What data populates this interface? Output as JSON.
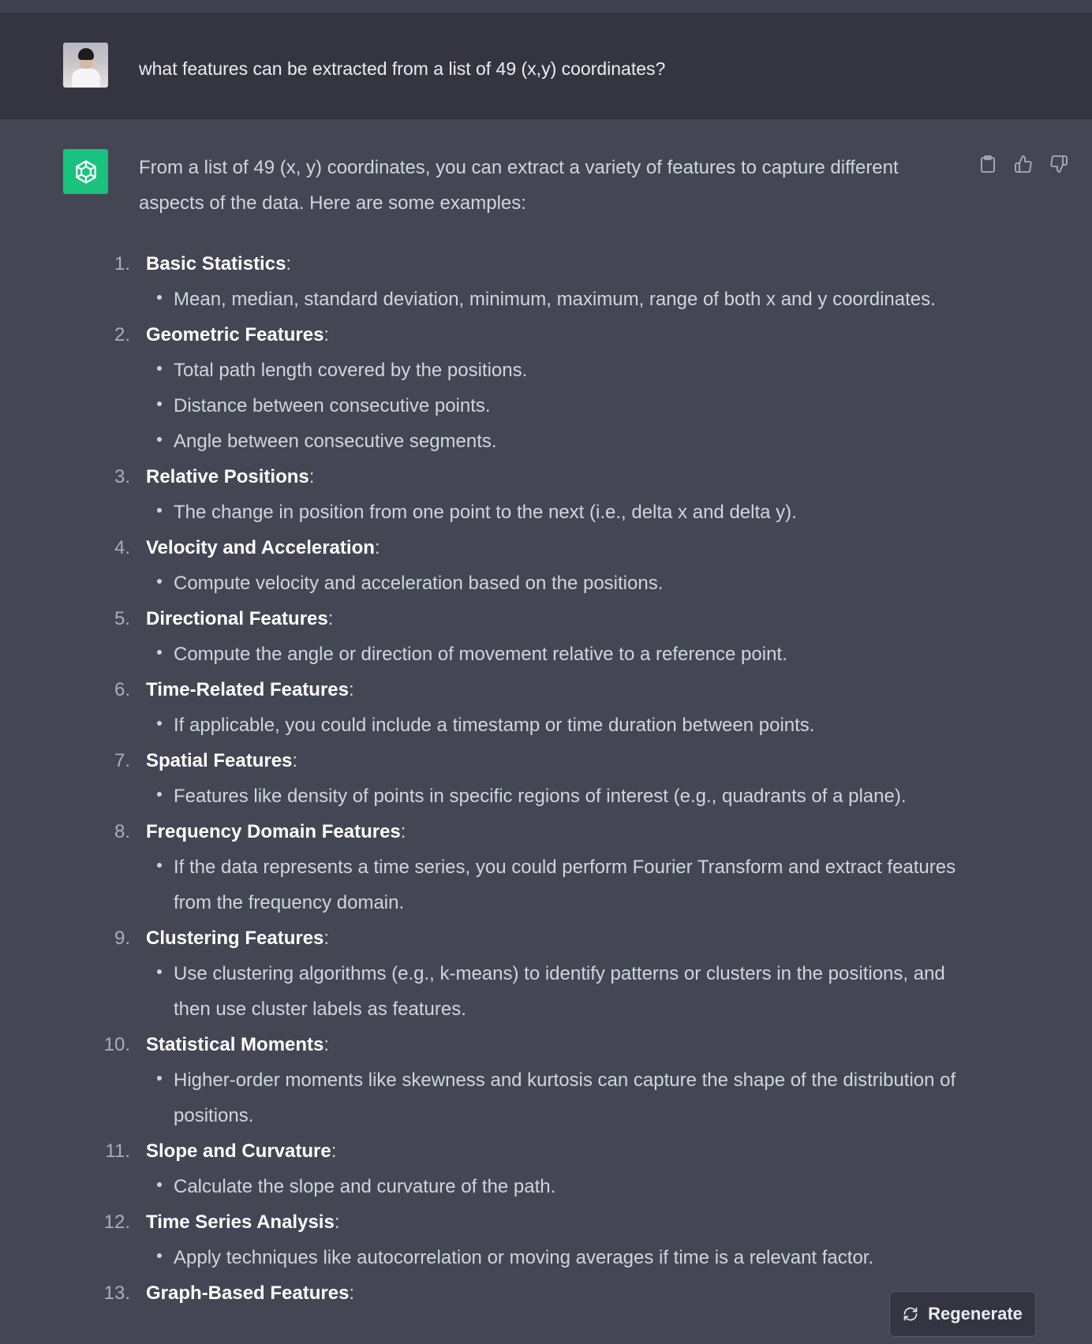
{
  "user_message": {
    "text": "what features can be extracted from a list of 49 (x,y) coordinates?"
  },
  "assistant_message": {
    "intro": "From a list of 49 (x, y) coordinates, you can extract a variety of features to capture different aspects of the data. Here are some examples:",
    "items": [
      {
        "number": "1.",
        "title": "Basic Statistics",
        "bullets": [
          "Mean, median, standard deviation, minimum, maximum, range of both x and y coordinates."
        ]
      },
      {
        "number": "2.",
        "title": "Geometric Features",
        "bullets": [
          "Total path length covered by the positions.",
          "Distance between consecutive points.",
          "Angle between consecutive segments."
        ]
      },
      {
        "number": "3.",
        "title": "Relative Positions",
        "bullets": [
          "The change in position from one point to the next (i.e., delta x and delta y)."
        ]
      },
      {
        "number": "4.",
        "title": "Velocity and Acceleration",
        "bullets": [
          "Compute velocity and acceleration based on the positions."
        ]
      },
      {
        "number": "5.",
        "title": "Directional Features",
        "bullets": [
          "Compute the angle or direction of movement relative to a reference point."
        ]
      },
      {
        "number": "6.",
        "title": "Time-Related Features",
        "bullets": [
          "If applicable, you could include a timestamp or time duration between points."
        ]
      },
      {
        "number": "7.",
        "title": "Spatial Features",
        "bullets": [
          "Features like density of points in specific regions of interest (e.g., quadrants of a plane)."
        ]
      },
      {
        "number": "8.",
        "title": "Frequency Domain Features",
        "bullets": [
          "If the data represents a time series, you could perform Fourier Transform and extract features from the frequency domain."
        ]
      },
      {
        "number": "9.",
        "title": "Clustering Features",
        "bullets": [
          "Use clustering algorithms (e.g., k-means) to identify patterns or clusters in the positions, and then use cluster labels as features."
        ]
      },
      {
        "number": "10.",
        "title": "Statistical Moments",
        "bullets": [
          "Higher-order moments like skewness and kurtosis can capture the shape of the distribution of positions."
        ]
      },
      {
        "number": "11.",
        "title": "Slope and Curvature",
        "bullets": [
          "Calculate the slope and curvature of the path."
        ]
      },
      {
        "number": "12.",
        "title": "Time Series Analysis",
        "bullets": [
          "Apply techniques like autocorrelation or moving averages if time is a relevant factor."
        ]
      },
      {
        "number": "13.",
        "title": "Graph-Based Features",
        "bullets": []
      }
    ]
  },
  "actions": {
    "copy_icon": "clipboard-icon",
    "like_icon": "thumbs-up-icon",
    "dislike_icon": "thumbs-down-icon"
  },
  "regenerate": {
    "label": "Regenerate",
    "icon": "refresh-icon"
  },
  "colors": {
    "assistant_bg": "#444654",
    "user_bg": "#343541",
    "accent": "#19c37d"
  }
}
